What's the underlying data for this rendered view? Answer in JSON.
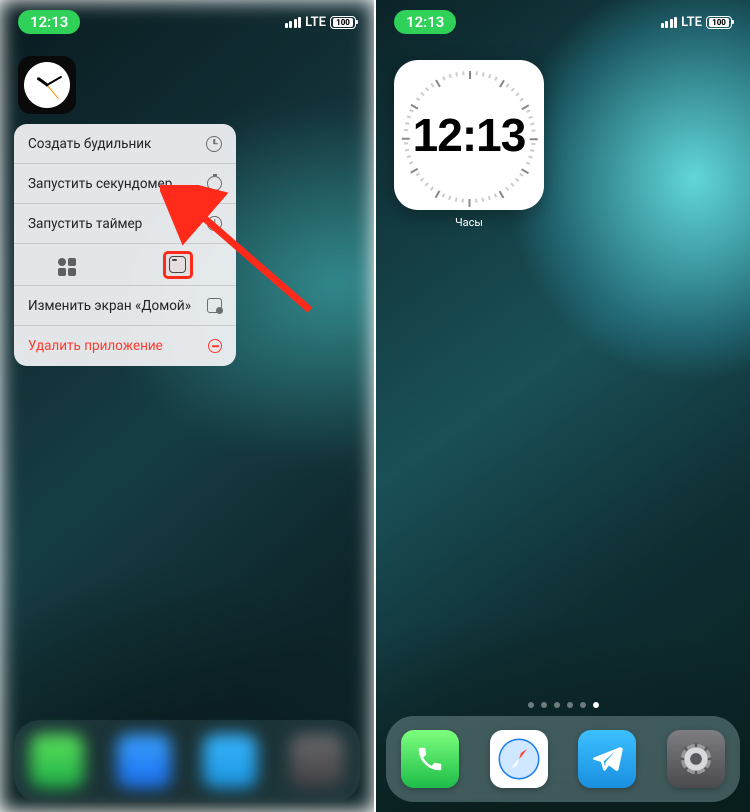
{
  "statusbar": {
    "time": "12:13",
    "network": "LTE",
    "battery": "100"
  },
  "left": {
    "context_menu": {
      "create_alarm": "Создать будильник",
      "start_stopwatch": "Запустить секундомер",
      "start_timer": "Запустить таймер",
      "edit_home": "Изменить экран «Домой»",
      "delete_app": "Удалить приложение"
    }
  },
  "right": {
    "widget_time": "12:13",
    "widget_label": "Часы",
    "page_count": 6,
    "page_active_index": 5
  }
}
